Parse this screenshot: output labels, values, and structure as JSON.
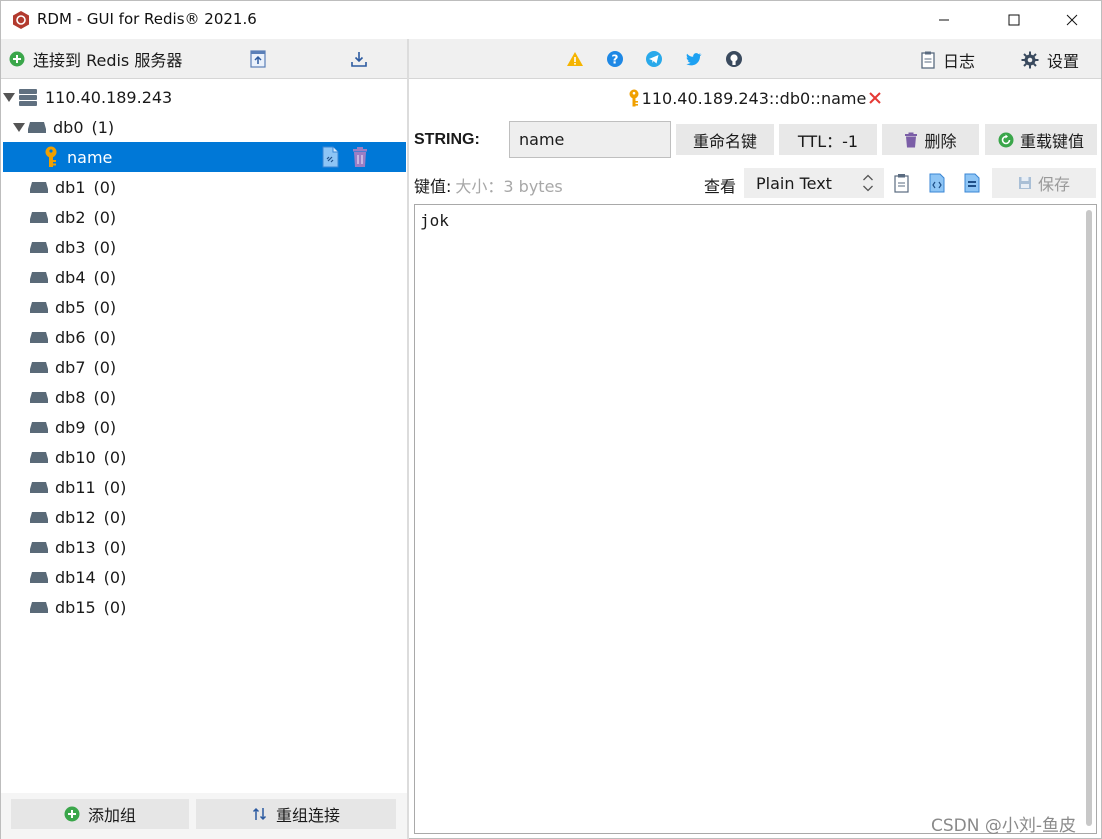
{
  "window": {
    "title": "RDM - GUI for Redis® 2021.6"
  },
  "left_toolbar": {
    "connect_label": "连接到 Redis 服务器"
  },
  "right_toolbar": {
    "log_label": "日志",
    "settings_label": "设置"
  },
  "tree": {
    "server": "110.40.189.243",
    "databases": [
      {
        "name": "db0",
        "count": "(1)"
      },
      {
        "name": "db1",
        "count": "(0)"
      },
      {
        "name": "db2",
        "count": "(0)"
      },
      {
        "name": "db3",
        "count": "(0)"
      },
      {
        "name": "db4",
        "count": "(0)"
      },
      {
        "name": "db5",
        "count": "(0)"
      },
      {
        "name": "db6",
        "count": "(0)"
      },
      {
        "name": "db7",
        "count": "(0)"
      },
      {
        "name": "db8",
        "count": "(0)"
      },
      {
        "name": "db9",
        "count": "(0)"
      },
      {
        "name": "db10",
        "count": "(0)"
      },
      {
        "name": "db11",
        "count": "(0)"
      },
      {
        "name": "db12",
        "count": "(0)"
      },
      {
        "name": "db13",
        "count": "(0)"
      },
      {
        "name": "db14",
        "count": "(0)"
      },
      {
        "name": "db15",
        "count": "(0)"
      }
    ],
    "selected_key": "name"
  },
  "left_bottom": {
    "add_group_label": "添加组",
    "regroup_label": "重组连接"
  },
  "tab": {
    "title": "110.40.189.243::db0::name"
  },
  "key_bar": {
    "type_label": "STRING:",
    "key_name": "name",
    "rename_label": "重命名键",
    "ttl_label": "TTL：-1",
    "delete_label": "删除",
    "reload_label": "重载键值"
  },
  "value_bar": {
    "value_label": "键值:",
    "size_label": "大小：3 bytes",
    "view_label": "查看",
    "format": "Plain Text",
    "save_label": "保存"
  },
  "editor": {
    "content": "jok"
  },
  "watermark": "CSDN @小刘-鱼皮",
  "colors": {
    "selection": "#0078d7",
    "key_icon": "#f0a000",
    "delete_icon": "#7b5ea7",
    "add_icon": "#3aa64a"
  }
}
